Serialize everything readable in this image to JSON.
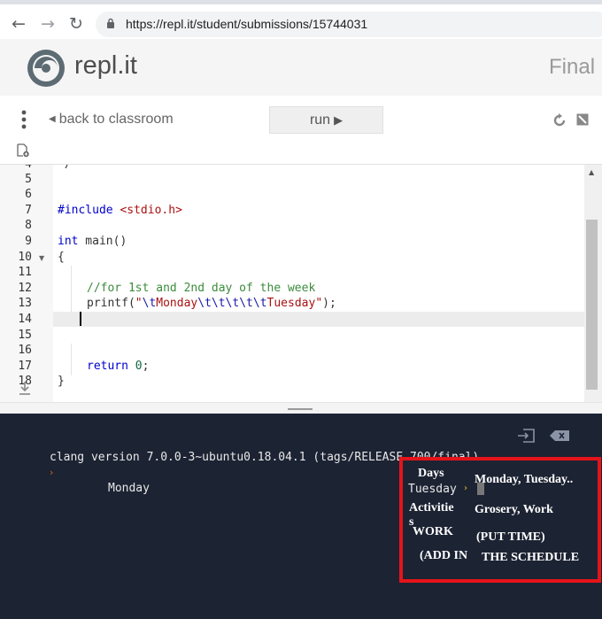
{
  "browser": {
    "url": "https://repl.it/student/submissions/15744031",
    "nav_back": "←",
    "nav_forward": "→",
    "nav_reload": "↻"
  },
  "site": {
    "logo_text": "repl.it",
    "page_heading": "Final P",
    "brand_color": "#4d4d4d"
  },
  "toolbar": {
    "back_label": "back to classroom",
    "run_label": "run",
    "icons": [
      "kebab-icon",
      "refresh-icon",
      "expand-icon",
      "add-file-icon"
    ]
  },
  "editor": {
    "line_numbers": [
      "4",
      "5",
      "6",
      "7",
      "8",
      "9",
      "10",
      "11",
      "12",
      "13",
      "14",
      "15",
      "16",
      "17",
      "18"
    ],
    "active_line": "14",
    "code": {
      "l4": "*/",
      "l7_directive": "#include",
      "l7_header": "<stdio.h>",
      "l9_type": "int",
      "l9_rest": " main()",
      "l10": "{",
      "l12": "//for 1st and 2nd day of the week",
      "l13_call": "printf(",
      "l13_q1": "\"",
      "l13_esc1": "\\t",
      "l13_word1": "Monday",
      "l13_esc2": "\\t\\t\\t\\t\\t",
      "l13_word2": "Tuesday",
      "l13_q2": "\"",
      "l13_end": ");",
      "l17_kw": "return",
      "l17_num": "0",
      "l17_end": ";",
      "l18": "}"
    }
  },
  "console": {
    "version_line": "clang version 7.0.0-3~ubuntu0.18.04.1 (tags/RELEASE_700/final)",
    "prompt_glyph": "›",
    "output_line": "\tMonday",
    "background": "#1c2333"
  },
  "schedule_overlay": {
    "border_color": "#e5141a",
    "days_label": "Days",
    "tuesday_output": "Tuesday",
    "days_value": "Monday, Tuesday..",
    "activities_label_1": "Activitie",
    "activities_label_2": "s",
    "activities_value": "Grosery, Work",
    "work_label": "WORK",
    "put_time": "(PUT TIME)",
    "add_in": "(ADD IN",
    "the_schedule": "THE SCHEDULE"
  }
}
